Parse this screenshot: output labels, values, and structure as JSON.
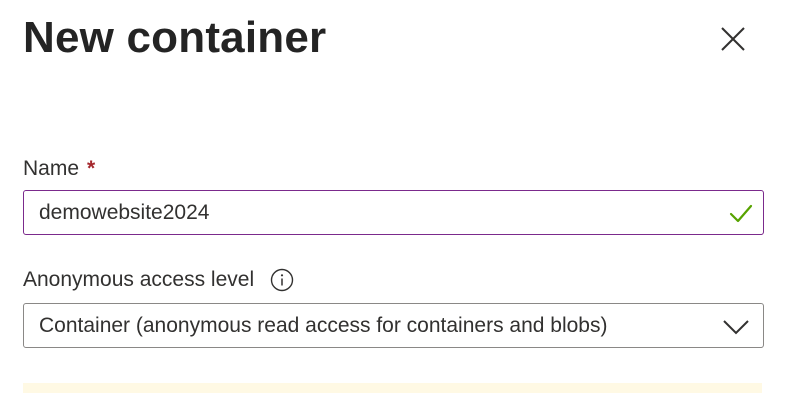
{
  "dialog": {
    "title": "New container"
  },
  "name_field": {
    "label": "Name",
    "required_marker": "*",
    "value": "demowebsite2024",
    "validation_icon": "checkmark-icon",
    "validation_color": "#57a300"
  },
  "access_field": {
    "label": "Anonymous access level",
    "info_icon": "info-icon",
    "selected": "Container (anonymous read access for containers and blobs)"
  },
  "colors": {
    "focus_border": "#7b2a8c",
    "required": "#a4262c",
    "warning_background": "#fff4ce"
  }
}
